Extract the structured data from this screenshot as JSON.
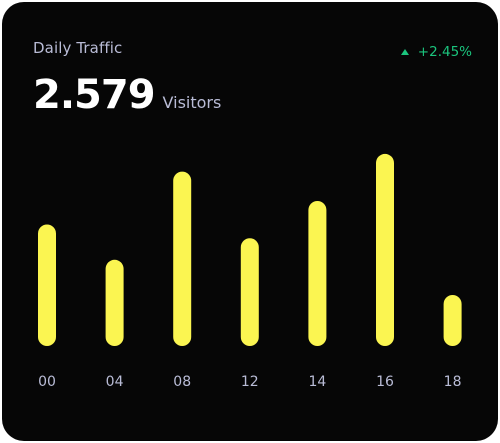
{
  "card": {
    "title": "Daily Traffic",
    "trend": "+2.45%",
    "trend_color": "#1bc47d",
    "value": "2.579",
    "unit": "Visitors"
  },
  "chart_data": {
    "type": "bar",
    "categories": [
      "00",
      "04",
      "08",
      "12",
      "14",
      "16",
      "18"
    ],
    "values": [
      62,
      44,
      89,
      55,
      74,
      98,
      26
    ],
    "ylim": [
      0,
      100
    ],
    "grid": false,
    "bar_color": "#fbf551",
    "label_color": "#b9bcd6"
  }
}
